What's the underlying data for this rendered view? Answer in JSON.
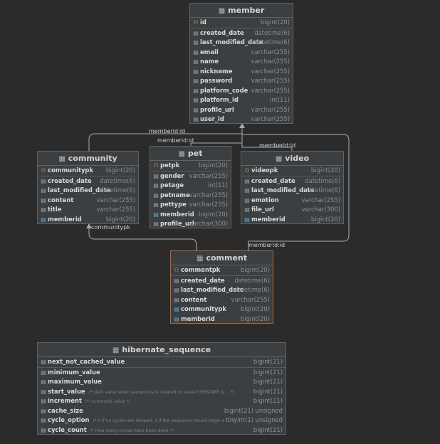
{
  "tables": {
    "member": {
      "title": "member",
      "columns": [
        {
          "name": "id",
          "type": "bigint(20)",
          "key": "pk"
        },
        {
          "name": "created_date",
          "type": "datetime(6)",
          "key": ""
        },
        {
          "name": "last_modified_date",
          "type": "datetime(6)",
          "key": ""
        },
        {
          "name": "email",
          "type": "varchar(255)",
          "key": ""
        },
        {
          "name": "name",
          "type": "varchar(255)",
          "key": ""
        },
        {
          "name": "nickname",
          "type": "varchar(255)",
          "key": ""
        },
        {
          "name": "password",
          "type": "varchar(255)",
          "key": ""
        },
        {
          "name": "platform_code",
          "type": "varchar(255)",
          "key": ""
        },
        {
          "name": "platform_id",
          "type": "int(11)",
          "key": ""
        },
        {
          "name": "profile_url",
          "type": "varchar(255)",
          "key": ""
        },
        {
          "name": "user_id",
          "type": "varchar(255)",
          "key": ""
        }
      ]
    },
    "community": {
      "title": "community",
      "columns": [
        {
          "name": "communitypk",
          "type": "bigint(20)",
          "key": "pk"
        },
        {
          "name": "created_date",
          "type": "datetime(6)",
          "key": ""
        },
        {
          "name": "last_modified_date",
          "type": "datetime(6)",
          "key": ""
        },
        {
          "name": "content",
          "type": "varchar(255)",
          "key": ""
        },
        {
          "name": "title",
          "type": "varchar(255)",
          "key": ""
        },
        {
          "name": "memberid",
          "type": "bigint(20)",
          "key": "fk"
        }
      ]
    },
    "pet": {
      "title": "pet",
      "columns": [
        {
          "name": "petpk",
          "type": "bigint(20)",
          "key": "pk"
        },
        {
          "name": "gender",
          "type": "varchar(255)",
          "key": ""
        },
        {
          "name": "petage",
          "type": "int(11)",
          "key": ""
        },
        {
          "name": "petname",
          "type": "varchar(255)",
          "key": ""
        },
        {
          "name": "pettype",
          "type": "varchar(255)",
          "key": ""
        },
        {
          "name": "memberid",
          "type": "bigint(20)",
          "key": "fk"
        },
        {
          "name": "profile_url",
          "type": "varchar(300)",
          "key": ""
        }
      ]
    },
    "video": {
      "title": "video",
      "columns": [
        {
          "name": "videopk",
          "type": "bigint(20)",
          "key": "pk"
        },
        {
          "name": "created_date",
          "type": "datetime(6)",
          "key": ""
        },
        {
          "name": "last_modified_date",
          "type": "datetime(6)",
          "key": ""
        },
        {
          "name": "emotion",
          "type": "varchar(255)",
          "key": ""
        },
        {
          "name": "file_url",
          "type": "varchar(300)",
          "key": ""
        },
        {
          "name": "memberid",
          "type": "bigint(20)",
          "key": "fk"
        }
      ]
    },
    "comment": {
      "title": "comment",
      "columns": [
        {
          "name": "commentpk",
          "type": "bigint(20)",
          "key": "pk"
        },
        {
          "name": "created_date",
          "type": "datetime(6)",
          "key": ""
        },
        {
          "name": "last_modified_date",
          "type": "datetime(6)",
          "key": ""
        },
        {
          "name": "content",
          "type": "varchar(255)",
          "key": ""
        },
        {
          "name": "communitypk",
          "type": "bigint(20)",
          "key": "fk"
        },
        {
          "name": "memberid",
          "type": "bigint(20)",
          "key": "fk"
        }
      ]
    },
    "hibernate_sequence": {
      "title": "hibernate_sequence",
      "columns": [
        {
          "name": "next_not_cached_value",
          "type": "bigint(21)",
          "key": "",
          "comment": ""
        },
        {
          "name": "minimum_value",
          "type": "bigint(21)",
          "key": "",
          "comment": ""
        },
        {
          "name": "maximum_value",
          "type": "bigint(21)",
          "key": "",
          "comment": ""
        },
        {
          "name": "start_value",
          "type": "bigint(21)",
          "key": "",
          "comment": "/* start value when sequences is created or value if RESTART is ... */"
        },
        {
          "name": "increment",
          "type": "bigint(21)",
          "key": "",
          "comment": "/* increment value */"
        },
        {
          "name": "cache_size",
          "type": "bigint(21) unsigned",
          "key": "",
          "comment": ""
        },
        {
          "name": "cycle_option",
          "type": "tinyint(1) unsigned",
          "key": "",
          "comment": "/* 0 if no cycles are allowed, 1 if the sequence should begin a ... */"
        },
        {
          "name": "cycle_count",
          "type": "bigint(21)",
          "key": "",
          "comment": "/* How many cycles have been done */"
        }
      ]
    }
  },
  "relations": {
    "community_member": "memberid:id",
    "pet_member": "memberid:id",
    "video_member": "memberid:id",
    "comment_member": "memberid:id",
    "comment_community": "communitypk"
  },
  "colors": {
    "background": "#2b2b2b",
    "table_bg": "#3c3f41",
    "selected_border": "#b8672b",
    "pk_icon": "#d4b24a",
    "fk_icon": "#5aa6d8",
    "line": "#a9acaf"
  },
  "icons": {
    "table": "table-icon",
    "primary_key": "primary-key-icon",
    "foreign_key": "foreign-key-icon",
    "column": "column-icon"
  }
}
